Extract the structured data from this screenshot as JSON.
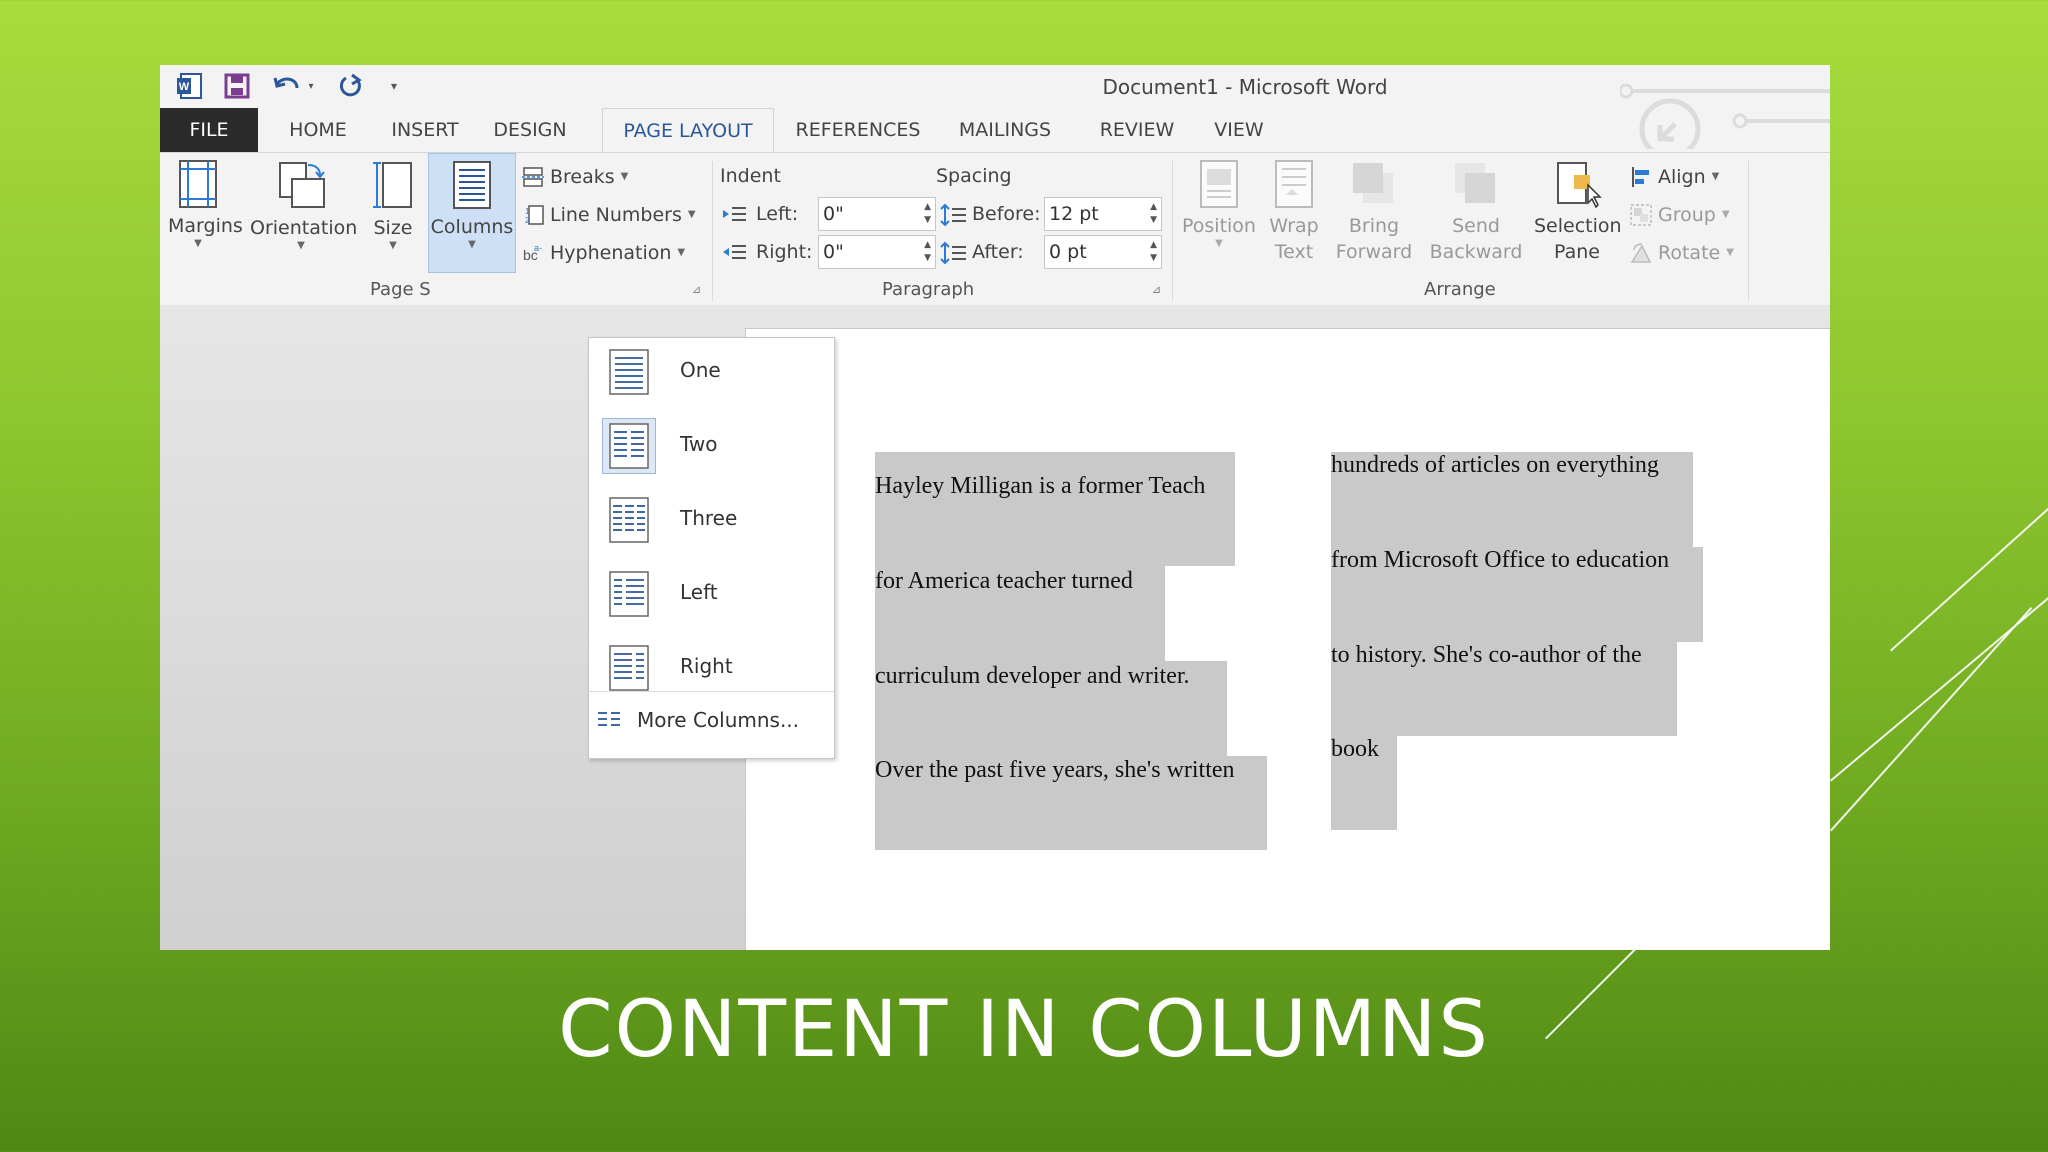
{
  "window": {
    "title": "Document1 - Microsoft Word"
  },
  "quick_access": {
    "icons": [
      "word-logo-icon",
      "save-icon",
      "undo-icon",
      "undo-dropdown-icon",
      "redo-icon",
      "customize-qat-icon"
    ]
  },
  "tabs": [
    {
      "label": "FILE"
    },
    {
      "label": "HOME"
    },
    {
      "label": "INSERT"
    },
    {
      "label": "DESIGN"
    },
    {
      "label": "PAGE LAYOUT",
      "active": true
    },
    {
      "label": "REFERENCES"
    },
    {
      "label": "MAILINGS"
    },
    {
      "label": "REVIEW"
    },
    {
      "label": "VIEW"
    }
  ],
  "ribbon": {
    "page_setup": {
      "margins": "Margins",
      "orientation": "Orientation",
      "size": "Size",
      "columns": "Columns",
      "breaks": "Breaks",
      "line_numbers": "Line Numbers",
      "hyphenation": "Hyphenation",
      "group_label": "Page S"
    },
    "paragraph": {
      "indent_label": "Indent",
      "spacing_label": "Spacing",
      "left_label": "Left:",
      "left_value": "0\"",
      "right_label": "Right:",
      "right_value": "0\"",
      "before_label": "Before:",
      "before_value": "12 pt",
      "after_label": "After:",
      "after_value": "0 pt",
      "group_label": "Paragraph"
    },
    "arrange": {
      "position": "Position",
      "wrap_text_1": "Wrap",
      "wrap_text_2": "Text",
      "bring_forward_1": "Bring",
      "bring_forward_2": "Forward",
      "send_backward_1": "Send",
      "send_backward_2": "Backward",
      "selection_pane_1": "Selection",
      "selection_pane_2": "Pane",
      "align": "Align",
      "group": "Group",
      "rotate": "Rotate",
      "group_label": "Arrange"
    }
  },
  "columns_menu": {
    "items": [
      {
        "label": "One"
      },
      {
        "label": "Two",
        "selected": true
      },
      {
        "label": "Three"
      },
      {
        "label": "Left"
      },
      {
        "label": "Right"
      }
    ],
    "more": "More Columns..."
  },
  "document": {
    "column1": [
      "Hayley Milligan is a former Teach",
      "for America teacher turned",
      "curriculum developer and writer.",
      "Over the past five years, she's written"
    ],
    "column2": [
      "hundreds of articles on everything",
      "from Microsoft Office to education",
      "to history. She's co-author of the",
      "book"
    ]
  },
  "slide": {
    "title": "CONTENT IN COLUMNS"
  },
  "colors": {
    "accent": "#2b579a",
    "background_top": "#a8dc3c",
    "background_bottom": "#4f8815",
    "selection_highlight": "#c9c9c9"
  }
}
